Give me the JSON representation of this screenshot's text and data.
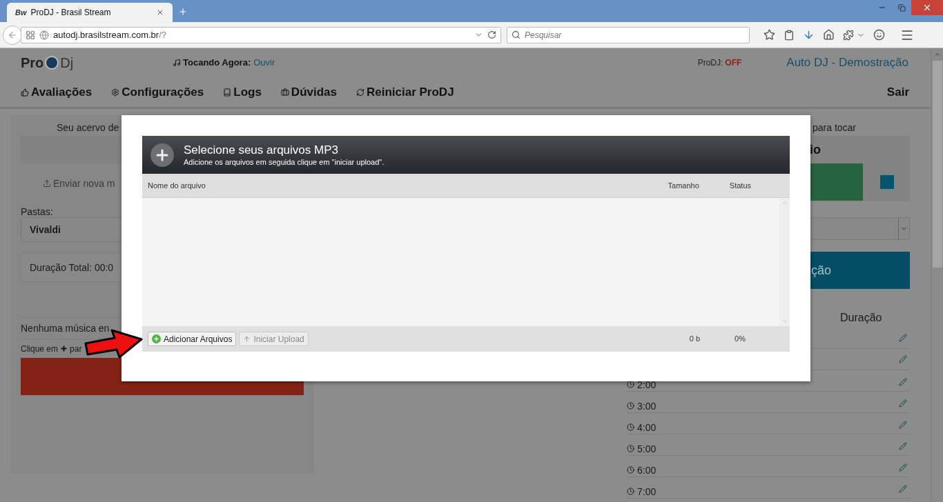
{
  "browser": {
    "tab": {
      "favicon": "Bw",
      "title": "ProDJ - Brasil Stream"
    },
    "url": {
      "host": "autodj.brasilstream.com.br",
      "path": "/?"
    },
    "search": {
      "placeholder": "Pesquisar"
    }
  },
  "header": {
    "logo": {
      "left": "Pro",
      "right": "Dj"
    },
    "now_playing": {
      "label": "Tocando Agora:",
      "link": "Ouvir"
    },
    "status": {
      "label": "ProDJ:",
      "value": "OFF"
    },
    "account": "Auto DJ - Demostração"
  },
  "nav": {
    "items": [
      "Avaliações",
      "Configurações",
      "Logs",
      "Dúvidas",
      "Reiniciar ProDJ"
    ],
    "logout": "Sair"
  },
  "library": {
    "title": "Seu acervo de",
    "upload": "Enviar nova m",
    "folders_label": "Pastas:",
    "folder": "Vivaldi",
    "total": "Duração Total: 00:0",
    "empty": "Nenhuma música en",
    "hint": {
      "before": "Clique em",
      "after": "par"
    }
  },
  "queue": {
    "title": "para tocar",
    "heading": "io",
    "playlist_button": "ção",
    "duration_header": "Duração",
    "rows": [
      {
        "kind": "edit-only"
      },
      {
        "kind": "edit-only"
      },
      {
        "kind": "timed",
        "time": "2:00"
      },
      {
        "kind": "timed",
        "time": "3:00"
      },
      {
        "kind": "timed",
        "time": "4:00"
      },
      {
        "kind": "timed",
        "time": "5:00"
      },
      {
        "kind": "timed",
        "time": "6:00"
      },
      {
        "kind": "timed",
        "time": "7:00"
      }
    ]
  },
  "upload_dialog": {
    "title": "Selecione seus arquivos MP3",
    "subtitle": "Adicione os arquivos em seguida clique em \"iniciar upload\".",
    "columns": [
      "Nome do arquivo",
      "Tamanho",
      "Status"
    ],
    "buttons": [
      {
        "label": "Adicionar Arquivos",
        "disabled": false
      },
      {
        "label": "Iniciar Upload",
        "disabled": true
      }
    ],
    "total_size": "0 b",
    "total_status": "0%"
  }
}
